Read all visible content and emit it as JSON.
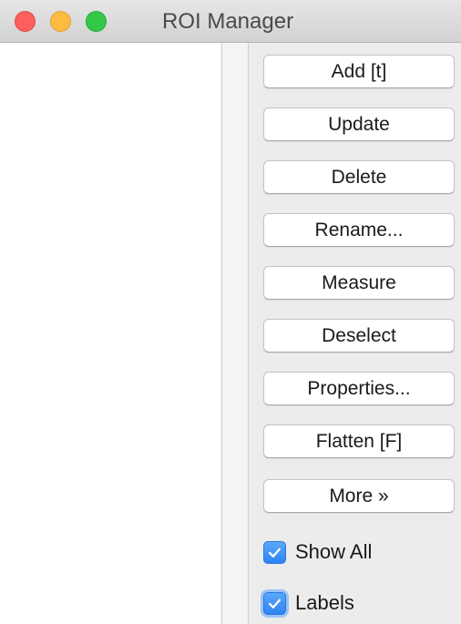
{
  "window": {
    "title": "ROI Manager"
  },
  "buttons": {
    "add": "Add [t]",
    "update": "Update",
    "delete": "Delete",
    "rename": "Rename...",
    "measure": "Measure",
    "deselect": "Deselect",
    "properties": "Properties...",
    "flatten": "Flatten [F]",
    "more": "More »"
  },
  "options": {
    "show_all": {
      "label": "Show All",
      "checked": true
    },
    "labels": {
      "label": "Labels",
      "checked": true
    }
  },
  "colors": {
    "accent": "#3b8ff5",
    "close": "#fc605c",
    "minimize": "#fdbc40",
    "zoom": "#34c84a"
  },
  "icons": {
    "close": "close-traffic-light-icon",
    "minimize": "minimize-traffic-light-icon",
    "zoom": "zoom-traffic-light-icon",
    "check": "checkmark-icon"
  }
}
